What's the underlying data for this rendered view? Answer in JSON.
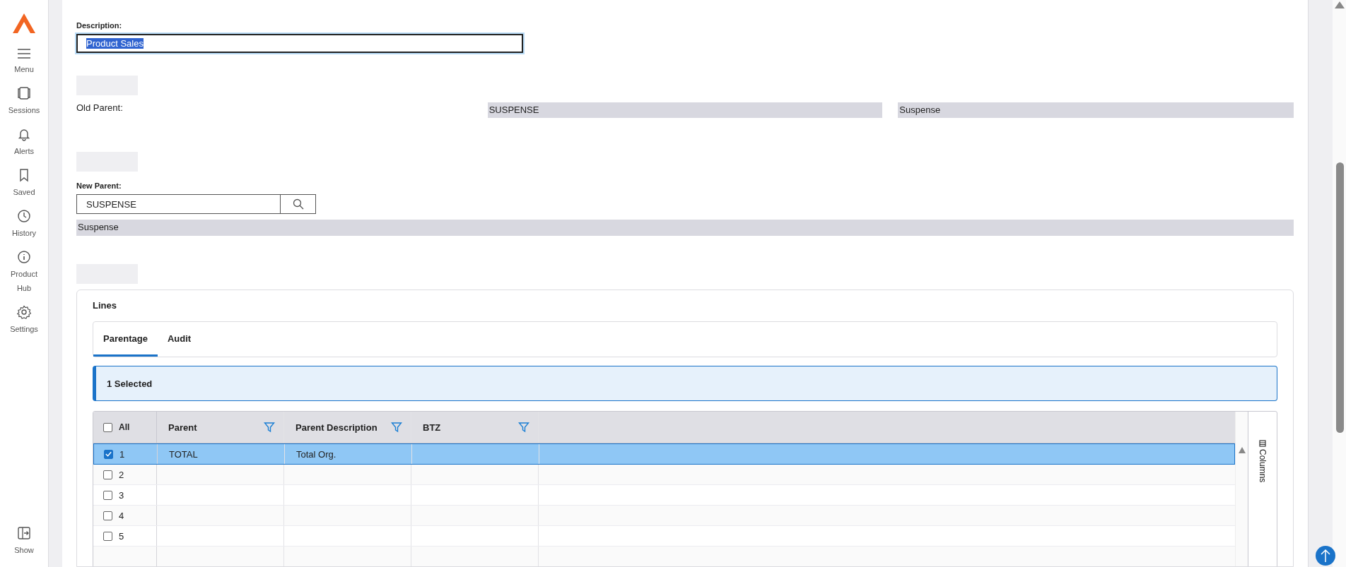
{
  "sidebar": {
    "items": [
      {
        "kind": "menu",
        "label": "Menu"
      },
      {
        "kind": "sessions",
        "label": "Sessions"
      },
      {
        "kind": "alerts",
        "label": "Alerts"
      },
      {
        "kind": "saved",
        "label": "Saved"
      },
      {
        "kind": "history",
        "label": "History"
      },
      {
        "kind": "info",
        "label": "Product Hub"
      },
      {
        "kind": "settings",
        "label": "Settings"
      }
    ],
    "bottom_item": {
      "kind": "show",
      "label": "Show"
    }
  },
  "form": {
    "description_label": "Description:",
    "description_value": "Product Sales",
    "old_parent_label": "Old Parent:",
    "old_parent_code": "SUSPENSE",
    "old_parent_name": "Suspense",
    "new_parent_label": "New Parent:",
    "new_parent_value": "SUSPENSE",
    "new_parent_name": "Suspense"
  },
  "lines": {
    "title": "Lines",
    "tabs": [
      {
        "label": "Parentage",
        "selected": true
      },
      {
        "label": "Audit",
        "selected": false
      }
    ],
    "banner": "1 Selected",
    "grid": {
      "all_label": "All",
      "all_checked": false,
      "columns": [
        "Parent",
        "Parent Description",
        "BTZ"
      ],
      "rows": [
        {
          "number": "1",
          "checked": true,
          "selected": true,
          "parent": "TOTAL",
          "description": "Total Org."
        },
        {
          "number": "2",
          "checked": false,
          "selected": false
        },
        {
          "number": "3",
          "checked": false,
          "selected": false
        },
        {
          "number": "4",
          "checked": false,
          "selected": false
        },
        {
          "number": "5",
          "checked": false,
          "selected": false
        }
      ]
    },
    "side_panel": "Columns"
  }
}
